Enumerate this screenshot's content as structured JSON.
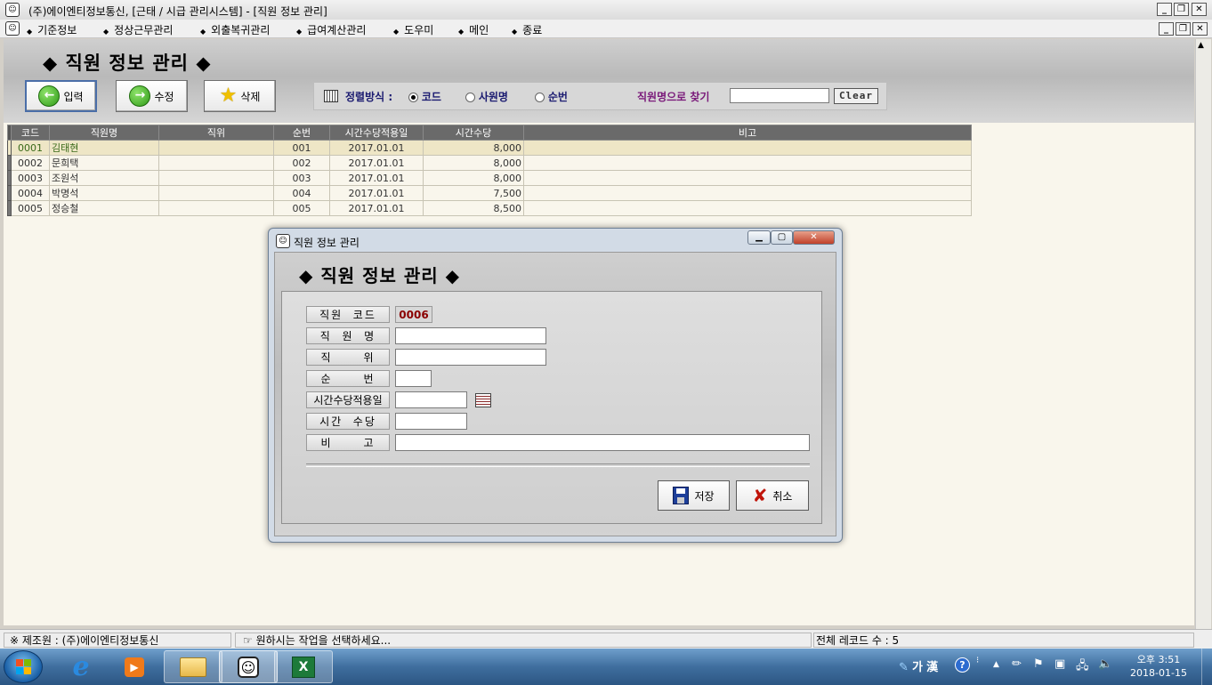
{
  "window": {
    "title": "(주)에이엔티정보통신, [근태 / 시급 관리시스템]  - [직원 정보 관리]"
  },
  "menu": {
    "items": [
      "기준정보",
      "정상근무관리",
      "외출복귀관리",
      "급여계산관리",
      "도우미",
      "메인",
      "종료"
    ]
  },
  "page": {
    "title": "◆ 직원 정보 관리 ◆"
  },
  "toolbar": {
    "input_label": "입력",
    "edit_label": "수정",
    "delete_label": "삭제"
  },
  "sort": {
    "label": "정렬방식 :",
    "options": [
      "코드",
      "사원명",
      "순번"
    ],
    "selected": "코드"
  },
  "search": {
    "label": "직원명으로 찾기",
    "value": "",
    "clear_label": "Clear"
  },
  "grid": {
    "columns": [
      "코드",
      "직원명",
      "직위",
      "순번",
      "시간수당적용일",
      "시간수당",
      "비고"
    ],
    "rows": [
      {
        "code": "0001",
        "name": "김태현",
        "position": "",
        "seq": "001",
        "date": "2017.01.01",
        "wage": "8,000",
        "note": ""
      },
      {
        "code": "0002",
        "name": "문희택",
        "position": "",
        "seq": "002",
        "date": "2017.01.01",
        "wage": "8,000",
        "note": ""
      },
      {
        "code": "0003",
        "name": "조원석",
        "position": "",
        "seq": "003",
        "date": "2017.01.01",
        "wage": "8,000",
        "note": ""
      },
      {
        "code": "0004",
        "name": "박명석",
        "position": "",
        "seq": "004",
        "date": "2017.01.01",
        "wage": "7,500",
        "note": ""
      },
      {
        "code": "0005",
        "name": "정승철",
        "position": "",
        "seq": "005",
        "date": "2017.01.01",
        "wage": "8,500",
        "note": ""
      }
    ]
  },
  "dialog": {
    "title": "직원 정보 관리",
    "heading": "◆ 직원 정보 관리 ◆",
    "fields": {
      "code_label": "직원  코드",
      "code_value": "0006",
      "name_label": "직  원  명",
      "name_value": "",
      "position_label": "직      위",
      "position_value": "",
      "seq_label": "순      번",
      "seq_value": "",
      "date_label": "시간수당적용일",
      "date_value": "",
      "wage_label": "시간  수당",
      "wage_value": "",
      "note_label": "비      고",
      "note_value": ""
    },
    "save_label": "저장",
    "cancel_label": "취소"
  },
  "status": {
    "maker": "※ 제조원 : (주)에이엔티정보통신",
    "message": "☞ 원하시는 작업을 선택하세요...",
    "record_count": "전체 레코드 수 : 5"
  },
  "taskbar": {
    "ime_hangul": "가",
    "ime_hanja": "漢",
    "time": "오후 3:51",
    "date": "2018-01-15"
  },
  "colors": {
    "taskbar": "#3f6e9e",
    "grid_header": "#6a6a6a",
    "selected_row": "#eee6c6",
    "code_value": "#8b0000"
  }
}
